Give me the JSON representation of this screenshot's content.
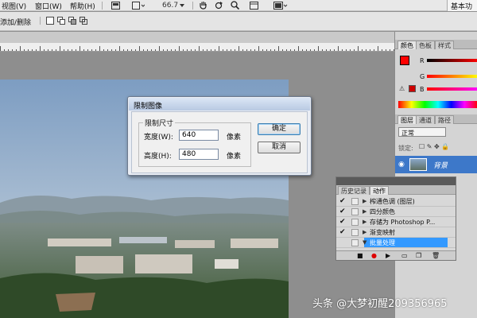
{
  "menubar": {
    "items": [
      "视图(V)",
      "窗口(W)",
      "帮助(H)"
    ],
    "zoom": "66.7",
    "workspace": "基本功"
  },
  "optionsbar": {
    "label": "添加/删除"
  },
  "dialog": {
    "title": "限制图像",
    "group_label": "限制尺寸",
    "width_label": "宽度(W):",
    "width_value": "640",
    "height_label": "高度(H):",
    "height_value": "480",
    "unit": "像素",
    "ok_label": "确定",
    "cancel_label": "取消"
  },
  "color_panel": {
    "tabs": [
      "颜色",
      "色板",
      "样式"
    ],
    "channels": [
      "R",
      "G",
      "B"
    ],
    "accent": "#ff0000"
  },
  "layers_panel": {
    "tabs": [
      "图层",
      "通道",
      "路径"
    ],
    "blend_mode": "正常",
    "lock_label": "锁定:",
    "layer_name": "背景"
  },
  "actions_panel": {
    "tabs": [
      "历史记录",
      "动作"
    ],
    "items": [
      {
        "label": "榨通色调 (图层)",
        "checked": true,
        "box": false
      },
      {
        "label": "四分颜色",
        "checked": true,
        "box": false
      },
      {
        "label": "存储为 Photoshop P...",
        "checked": true,
        "box": true
      },
      {
        "label": "渐变映射",
        "checked": true,
        "box": false
      },
      {
        "label": "批量处理",
        "checked": false,
        "box": false,
        "selected": true
      }
    ]
  },
  "watermark": "头条 @大梦初醒209356965"
}
